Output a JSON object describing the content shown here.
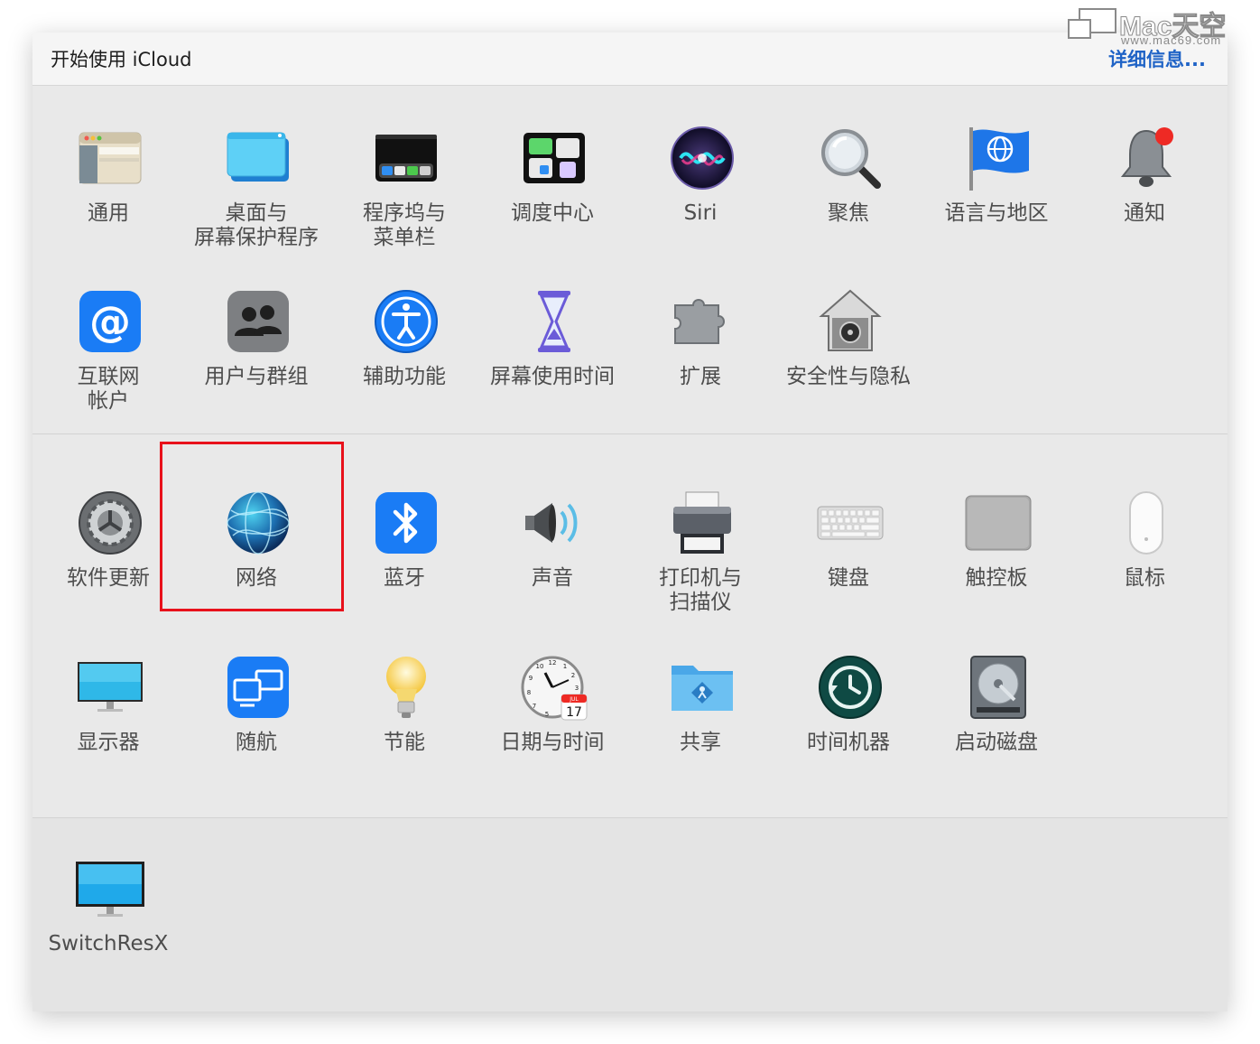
{
  "banner": {
    "title": "开始使用 iCloud",
    "link": "详细信息..."
  },
  "watermark": {
    "brand": "Mac天空",
    "site": "www.mac69.com"
  },
  "rows": {
    "row1": [
      {
        "label": "通用",
        "icon": "general-icon"
      },
      {
        "label": "桌面与\n屏幕保护程序",
        "icon": "desktop-screensaver-icon"
      },
      {
        "label": "程序坞与\n菜单栏",
        "icon": "dock-menubar-icon"
      },
      {
        "label": "调度中心",
        "icon": "mission-control-icon"
      },
      {
        "label": "Siri",
        "icon": "siri-icon"
      },
      {
        "label": "聚焦",
        "icon": "spotlight-icon"
      },
      {
        "label": "语言与地区",
        "icon": "language-region-icon"
      },
      {
        "label": "通知",
        "icon": "notifications-icon"
      }
    ],
    "row2": [
      {
        "label": "互联网\n帐户",
        "icon": "internet-accounts-icon"
      },
      {
        "label": "用户与群组",
        "icon": "users-groups-icon"
      },
      {
        "label": "辅助功能",
        "icon": "accessibility-icon"
      },
      {
        "label": "屏幕使用时间",
        "icon": "screen-time-icon"
      },
      {
        "label": "扩展",
        "icon": "extensions-icon"
      },
      {
        "label": "安全性与隐私",
        "icon": "security-privacy-icon"
      }
    ],
    "row3": [
      {
        "label": "软件更新",
        "icon": "software-update-icon"
      },
      {
        "label": "网络",
        "icon": "network-icon"
      },
      {
        "label": "蓝牙",
        "icon": "bluetooth-icon"
      },
      {
        "label": "声音",
        "icon": "sound-icon"
      },
      {
        "label": "打印机与\n扫描仪",
        "icon": "printers-scanners-icon"
      },
      {
        "label": "键盘",
        "icon": "keyboard-icon"
      },
      {
        "label": "触控板",
        "icon": "trackpad-icon"
      },
      {
        "label": "鼠标",
        "icon": "mouse-icon"
      }
    ],
    "row4": [
      {
        "label": "显示器",
        "icon": "displays-icon"
      },
      {
        "label": "随航",
        "icon": "sidecar-icon"
      },
      {
        "label": "节能",
        "icon": "energy-saver-icon"
      },
      {
        "label": "日期与时间",
        "icon": "date-time-icon"
      },
      {
        "label": "共享",
        "icon": "sharing-icon"
      },
      {
        "label": "时间机器",
        "icon": "time-machine-icon"
      },
      {
        "label": "启动磁盘",
        "icon": "startup-disk-icon"
      }
    ],
    "row5": [
      {
        "label": "SwitchResX",
        "icon": "switchresx-icon"
      }
    ]
  },
  "clock": {
    "month": "JUL",
    "day": "17",
    "numerals": [
      "12",
      "1",
      "2",
      "3",
      "4",
      "5",
      "6",
      "7",
      "8",
      "9",
      "10",
      "11"
    ]
  },
  "colors": {
    "highlight": "#e8111b",
    "link": "#1f63c6",
    "accent_blue": "#1a7cf5"
  }
}
